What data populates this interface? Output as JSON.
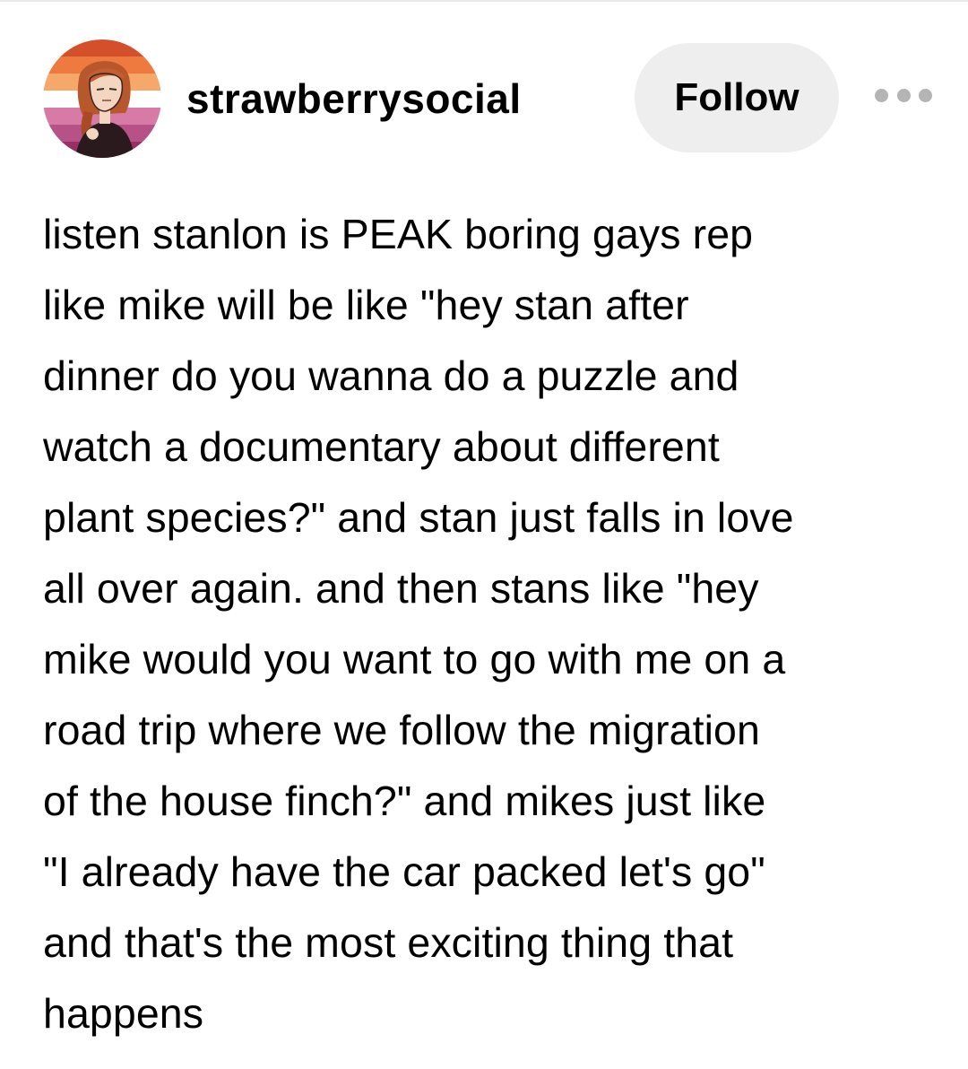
{
  "post": {
    "author": {
      "username": "strawberrysocial",
      "avatar": {
        "icon": "avatar-illustration-icon",
        "stripe_colors": [
          "#d4502b",
          "#ee7a3f",
          "#f6a76a",
          "#ffffff",
          "#d77aa6",
          "#b65287",
          "#9a2f64"
        ]
      }
    },
    "follow_label": "Follow",
    "more_icon": "ellipsis-icon",
    "body_text": "listen stanlon is PEAK boring gays rep\nlike mike will be like \"hey stan after\ndinner do you wanna do a puzzle and\nwatch a documentary about different\nplant species?\" and stan just falls in love\nall over again. and then stans like \"hey\nmike would you want to go with me on a\nroad trip where we follow the migration\nof the house finch?\" and mikes just like\n\"I already have the car packed let's go\"\nand that's the most exciting thing that\nhappens"
  }
}
